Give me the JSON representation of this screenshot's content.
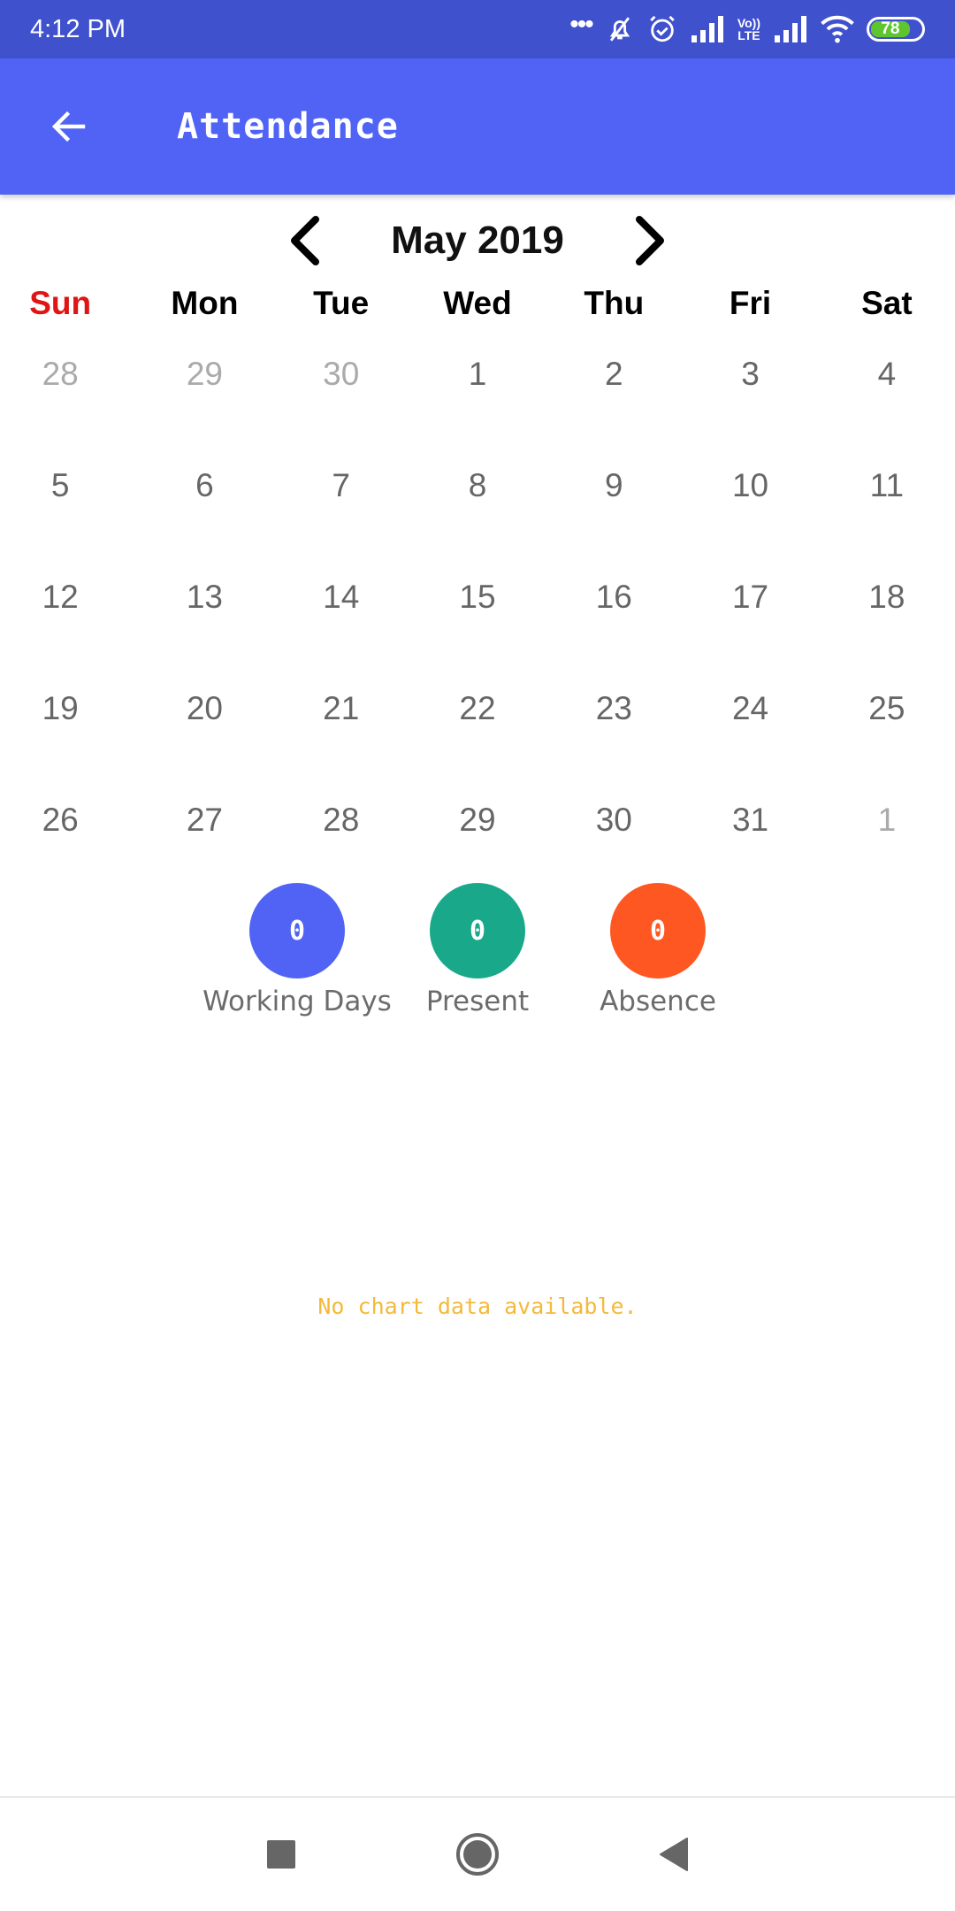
{
  "status_bar": {
    "time": "4:12 PM",
    "battery_level": "78",
    "icons": [
      "more-dots-icon",
      "mute-bell-icon",
      "alarm-icon",
      "signal-icon",
      "volte-icon",
      "signal-icon",
      "wifi-icon",
      "battery-icon"
    ],
    "volte_line1": "Vo))",
    "volte_line2": "LTE"
  },
  "app_bar": {
    "title": "Attendance",
    "back_icon": "arrow-left-icon",
    "color": "#5063f4"
  },
  "calendar": {
    "month_label": "May 2019",
    "prev_icon": "chevron-left-icon",
    "next_icon": "chevron-right-icon",
    "weekdays": [
      "Sun",
      "Mon",
      "Tue",
      "Wed",
      "Thu",
      "Fri",
      "Sat"
    ],
    "weeks": [
      [
        {
          "d": "28",
          "other": true
        },
        {
          "d": "29",
          "other": true
        },
        {
          "d": "30",
          "other": true
        },
        {
          "d": "1"
        },
        {
          "d": "2"
        },
        {
          "d": "3"
        },
        {
          "d": "4"
        }
      ],
      [
        {
          "d": "5"
        },
        {
          "d": "6"
        },
        {
          "d": "7"
        },
        {
          "d": "8"
        },
        {
          "d": "9"
        },
        {
          "d": "10"
        },
        {
          "d": "11"
        }
      ],
      [
        {
          "d": "12"
        },
        {
          "d": "13"
        },
        {
          "d": "14"
        },
        {
          "d": "15"
        },
        {
          "d": "16"
        },
        {
          "d": "17"
        },
        {
          "d": "18"
        }
      ],
      [
        {
          "d": "19"
        },
        {
          "d": "20"
        },
        {
          "d": "21"
        },
        {
          "d": "22"
        },
        {
          "d": "23"
        },
        {
          "d": "24"
        },
        {
          "d": "25"
        }
      ],
      [
        {
          "d": "26"
        },
        {
          "d": "27"
        },
        {
          "d": "28"
        },
        {
          "d": "29"
        },
        {
          "d": "30"
        },
        {
          "d": "31"
        },
        {
          "d": "1",
          "other": true
        }
      ]
    ]
  },
  "stats": [
    {
      "value": "0",
      "label": "Working Days",
      "color": "#5063f4"
    },
    {
      "value": "0",
      "label": "Present",
      "color": "#19a98a"
    },
    {
      "value": "0",
      "label": "Absence",
      "color": "#ff5722"
    }
  ],
  "chart": {
    "empty_message": "No chart data available."
  },
  "nav_bar": {
    "buttons": [
      "recents-square-icon",
      "home-circle-icon",
      "back-triangle-icon"
    ]
  }
}
